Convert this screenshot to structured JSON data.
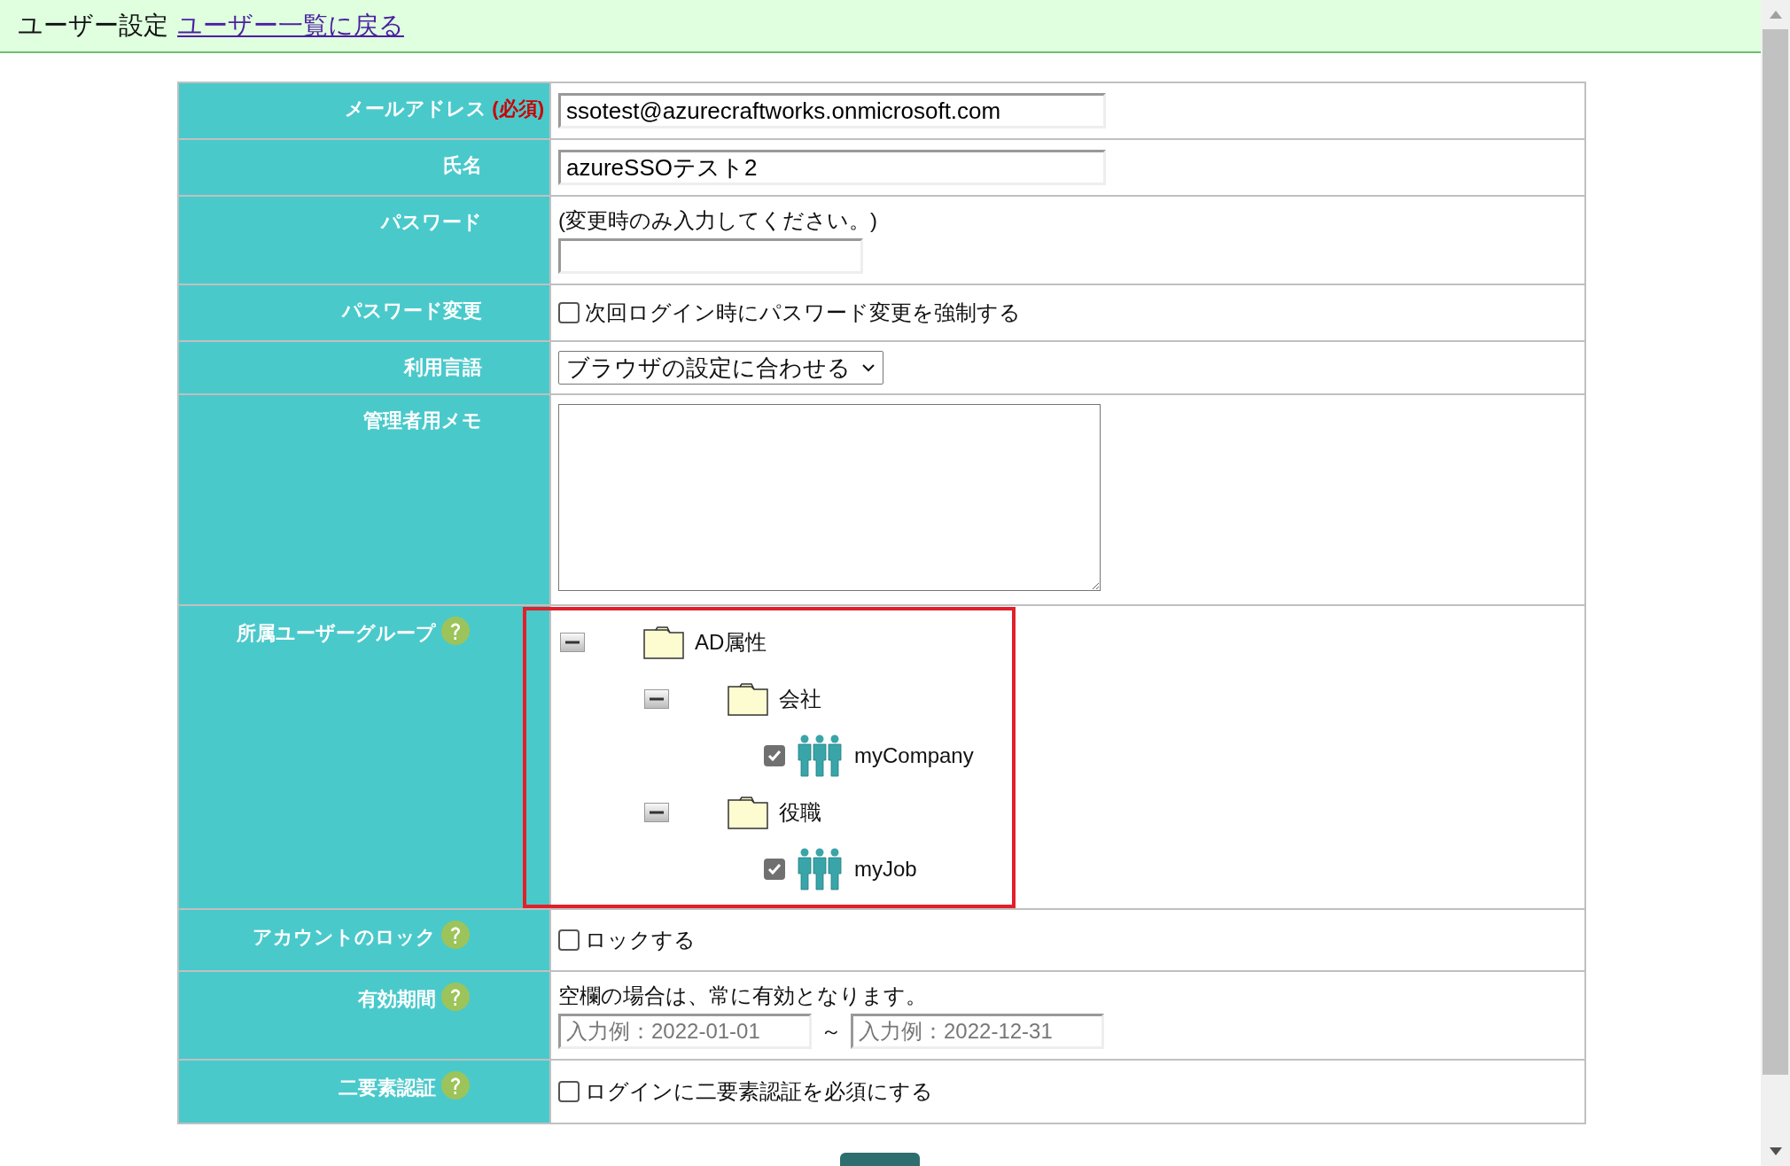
{
  "header": {
    "title": "ユーザー設定",
    "back_link": "ユーザー一覧に戻る"
  },
  "form": {
    "rows": [
      {
        "kind": "text",
        "label": "メールアドレス",
        "required": "(必須)",
        "value": "ssotest@azurecraftworks.onmicrosoft.com"
      },
      {
        "kind": "text",
        "label": "氏名",
        "value": "azureSSOテスト2"
      },
      {
        "kind": "password",
        "label": "パスワード",
        "note": "(変更時のみ入力してください。)"
      },
      {
        "kind": "checkbox",
        "label": "パスワード変更",
        "option": "次回ログイン時にパスワード変更を強制する",
        "checked": false
      },
      {
        "kind": "select",
        "label": "利用言語",
        "value": "ブラウザの設定に合わせる"
      },
      {
        "kind": "textarea",
        "label": "管理者用メモ"
      },
      {
        "kind": "tree",
        "label": "所属ユーザーグループ",
        "help": true,
        "highlighted": true,
        "tree": [
          {
            "kind": "folder",
            "label": "AD属性",
            "expanded": true,
            "children": [
              {
                "kind": "folder",
                "label": "会社",
                "expanded": true,
                "children": [
                  {
                    "kind": "group",
                    "label": "myCompany",
                    "checked": true
                  }
                ]
              },
              {
                "kind": "folder",
                "label": "役職",
                "expanded": true,
                "children": [
                  {
                    "kind": "group",
                    "label": "myJob",
                    "checked": true
                  }
                ]
              }
            ]
          }
        ]
      },
      {
        "kind": "checkbox",
        "label": "アカウントのロック",
        "help": true,
        "option": "ロックする",
        "checked": false
      },
      {
        "kind": "daterange",
        "label": "有効期間",
        "help": true,
        "note": "空欄の場合は、常に有効となります。",
        "from_placeholder": "入力例：2022-01-01",
        "separator": "～",
        "to_placeholder": "入力例：2022-12-31"
      },
      {
        "kind": "checkbox",
        "label": "二要素認証",
        "help": true,
        "option": "ログインに二要素認証を必須にする",
        "checked": false
      }
    ]
  }
}
